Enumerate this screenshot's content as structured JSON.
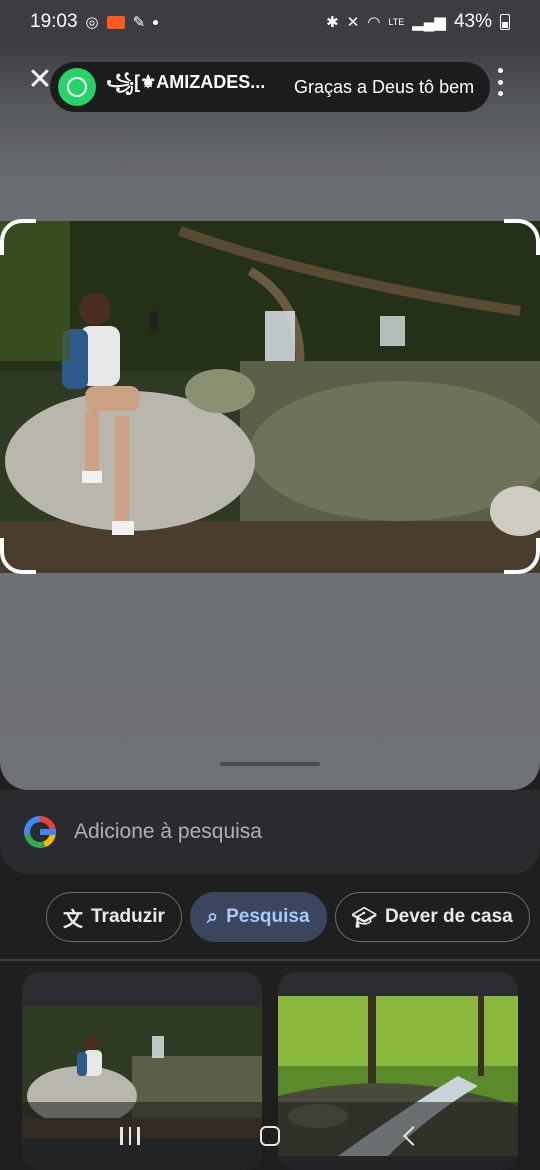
{
  "status_bar": {
    "time": "19:03",
    "battery": "43%",
    "network": "LTE"
  },
  "notification": {
    "app_icon": "whatsapp-icon",
    "sender": "꧁[⚜AMIZADES...",
    "message": "Graças a Deus tô bem"
  },
  "search": {
    "placeholder": "Adicione à pesquisa"
  },
  "chips": [
    {
      "label": "Traduzir",
      "icon": "translate-icon"
    },
    {
      "label": "Pesquisa",
      "icon": "search-icon"
    },
    {
      "label": "Dever de casa",
      "icon": "graduation-cap-icon"
    }
  ],
  "colors": {
    "accent_chip_bg": "#39465e",
    "accent_chip_text": "#a8c7fa",
    "whatsapp_green": "#25d366"
  }
}
